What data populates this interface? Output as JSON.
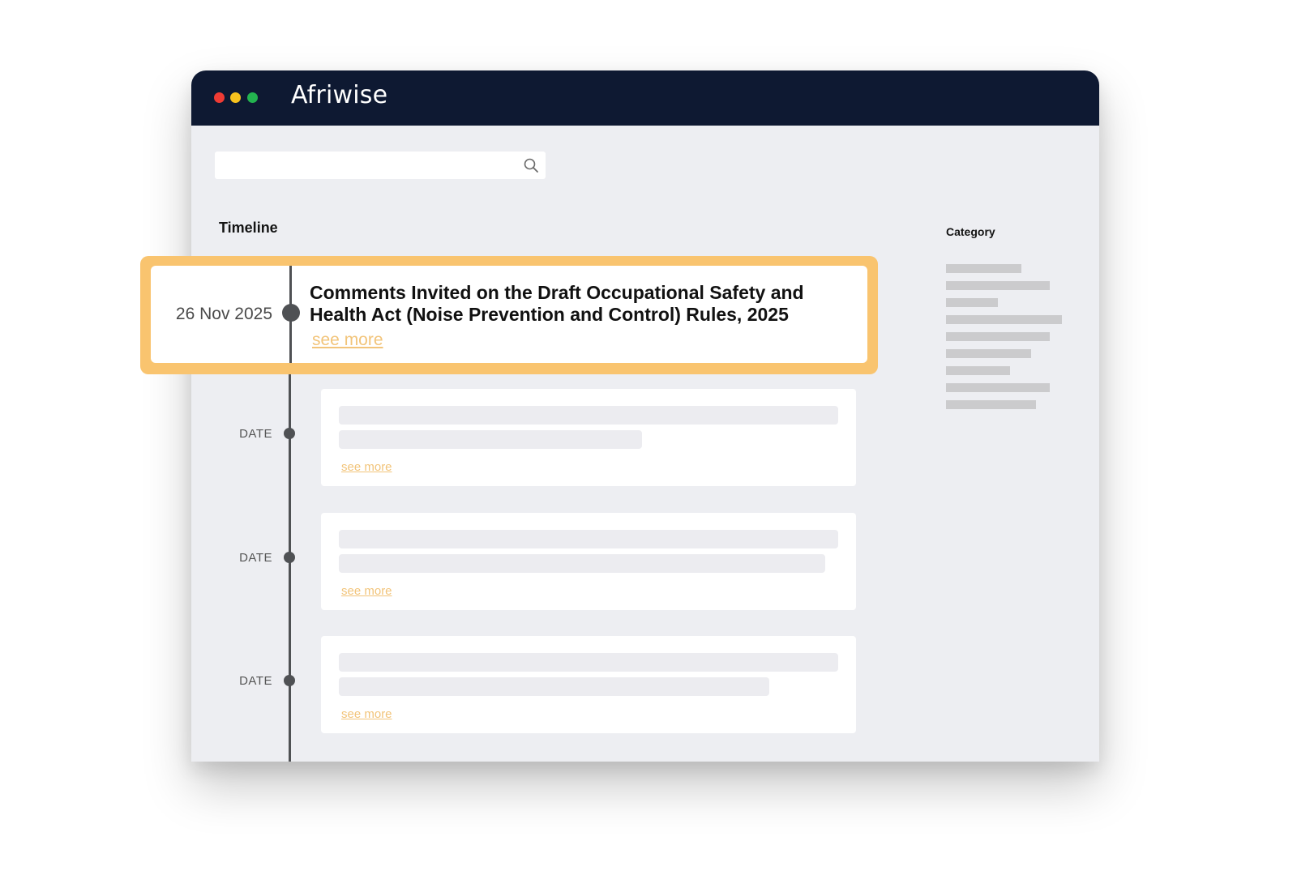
{
  "app": {
    "title": "Afriwise"
  },
  "window_colors": {
    "close": "#ef3b34",
    "minimize": "#f7c21e",
    "maximize": "#23b34f",
    "titlebar": "#0e1932",
    "accent": "#f9c46f"
  },
  "search": {
    "value": "",
    "placeholder": "",
    "icon": "search-icon"
  },
  "timeline": {
    "heading": "Timeline",
    "featured": {
      "date": "26 Nov 2025",
      "title": "Comments Invited on the Draft Occupational Safety and Health Act (Noise Prevention and Control) Rules, 2025",
      "link": "see more"
    },
    "items": [
      {
        "date": "DATE",
        "link": "see more"
      },
      {
        "date": "DATE",
        "link": "see more"
      },
      {
        "date": "DATE",
        "link": "see more"
      }
    ]
  },
  "category": {
    "heading": "Category"
  }
}
